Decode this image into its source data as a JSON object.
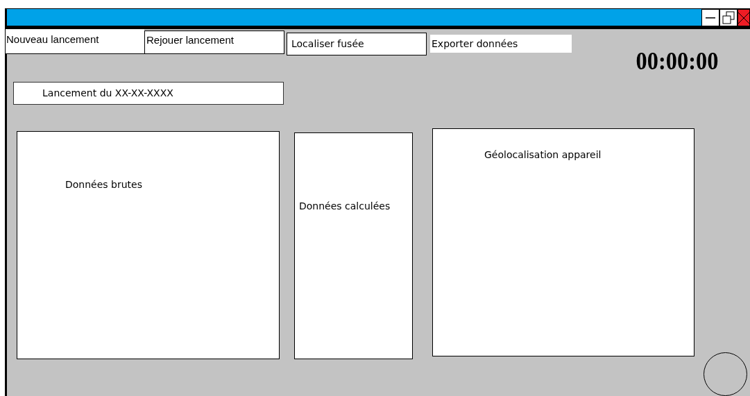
{
  "toolbar": [
    {
      "label": "Nouveau lancement"
    },
    {
      "label": "Rejouer lancement"
    },
    {
      "label": "Localiser fusée"
    },
    {
      "label": "Exporter données"
    }
  ],
  "timer": "00:00:00",
  "launch_title": "Lancement du XX-XX-XXXX",
  "panels": [
    {
      "label": "Données brutes"
    },
    {
      "label": "Données calculées"
    },
    {
      "label": "Géolocalisation appareil"
    }
  ]
}
